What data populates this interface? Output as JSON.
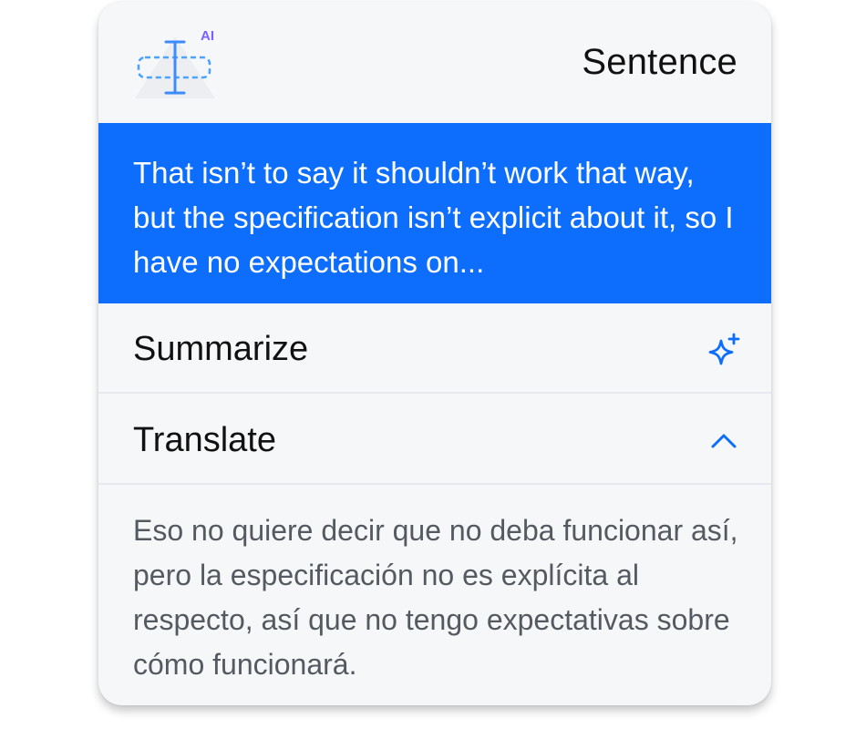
{
  "header": {
    "logo_badge": "AI",
    "title": "Sentence"
  },
  "selection": {
    "text": "That isn’t to say it shouldn’t work that way, but the specification isn’t explicit about it, so I have no expectations on..."
  },
  "actions": [
    {
      "label": "Summarize",
      "icon": "sparkle-icon"
    },
    {
      "label": "Translate",
      "icon": "chevron-up-icon"
    }
  ],
  "translation": {
    "text": "Eso no quiere decir que no deba funcionar así, pero la especificación no es explícita al respecto, así que no tengo expectativas sobre cómo funcionará."
  },
  "colors": {
    "accent": "#0d6efd",
    "background": "#f6f7f9",
    "translation_text": "#555a60"
  }
}
